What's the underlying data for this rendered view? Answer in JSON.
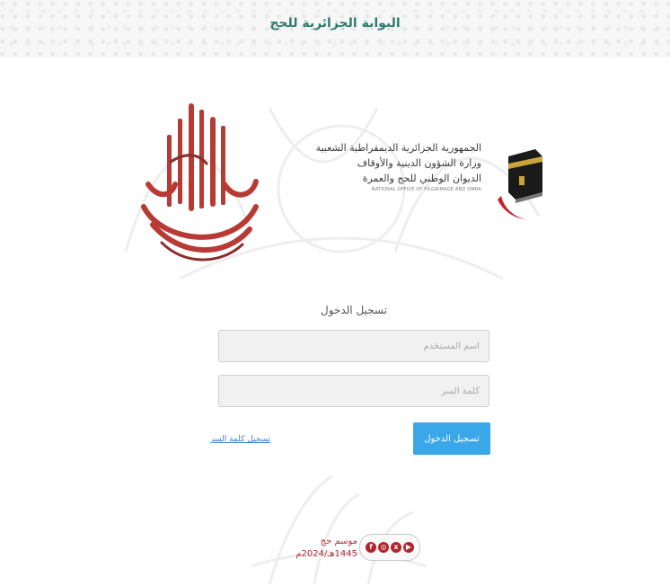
{
  "header": {
    "portal_title": "البوابة الجزائرية للحج"
  },
  "branding": {
    "line1": "الجمهورية الجزائرية الديمقراطية الشعبية",
    "line2": "وزارة الشؤون الدينية والأوقاف",
    "line3": "الديوان الوطني للحج والعمرة",
    "line4": "NATIONAL OFFICE OF PILGRIMAGE AND OMRA"
  },
  "login": {
    "title": "تسجيل الدخول",
    "username_placeholder": "اسم المستخدم",
    "password_placeholder": "كلمة السر",
    "submit_label": "تسجيل الدخول",
    "register_link": "تسجيل كلمة السر"
  },
  "footer": {
    "season_line1": "موسم حج",
    "season_line2": "1445هـ/2024م",
    "social_icons": [
      "facebook-icon",
      "instagram-icon",
      "x-icon",
      "youtube-icon"
    ]
  },
  "colors": {
    "brand_green": "#2c7d6b",
    "button_blue": "#3aa7e8",
    "accent_red": "#b2323a"
  }
}
